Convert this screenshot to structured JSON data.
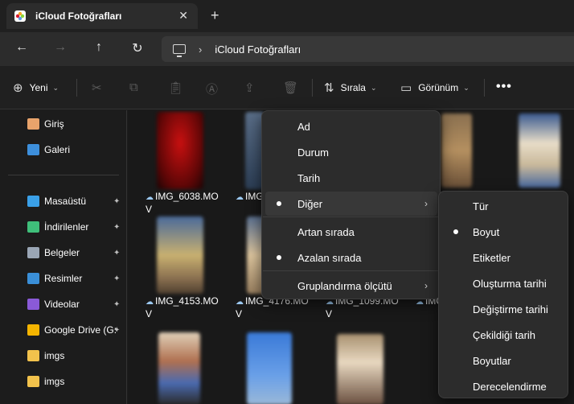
{
  "window": {
    "tab_title": "iCloud Fotoğrafları",
    "close_glyph": "✕",
    "new_tab_glyph": "+"
  },
  "nav": {
    "back_glyph": "←",
    "forward_glyph": "→",
    "up_glyph": "↑",
    "refresh_glyph": "↻",
    "breadcrumb_sep": "›",
    "path": "iCloud Fotoğrafları"
  },
  "toolbar": {
    "new_label": "Yeni",
    "sort_label": "Sırala",
    "view_label": "Görünüm",
    "more_label": "•••",
    "icons": [
      "cut-icon",
      "copy-icon",
      "paste-icon",
      "rename-icon",
      "share-icon",
      "delete-icon"
    ]
  },
  "sidebar": {
    "items": [
      {
        "label": "Giriş",
        "icon": "home-icon",
        "color": "#e8a36b",
        "pinned": false
      },
      {
        "label": "Galeri",
        "icon": "gallery-icon",
        "color": "#3d8fdc",
        "pinned": false
      },
      {
        "label": "Masaüstü",
        "icon": "desktop-icon",
        "color": "#3aa0e8",
        "pinned": true
      },
      {
        "label": "İndirilenler",
        "icon": "download-icon",
        "color": "#3fbf7a",
        "pinned": true
      },
      {
        "label": "Belgeler",
        "icon": "documents-icon",
        "color": "#9aa6b5",
        "pinned": true
      },
      {
        "label": "Resimler",
        "icon": "pictures-icon",
        "color": "#3a8fd8",
        "pinned": true
      },
      {
        "label": "Videolar",
        "icon": "videos-icon",
        "color": "#8a5ad8",
        "pinned": true
      },
      {
        "label": "Google Drive (G:",
        "icon": "google-drive-icon",
        "color": "#f4b400",
        "pinned": true
      },
      {
        "label": "imgs",
        "icon": "folder-icon",
        "color": "#f2c24c",
        "pinned": false
      },
      {
        "label": "imgs",
        "icon": "folder-icon",
        "color": "#f2c24c",
        "pinned": false
      }
    ],
    "pin_glyph": "📌"
  },
  "files": [
    {
      "name": "IMG_6038.MO\nV"
    },
    {
      "name": "IMG_"
    },
    {
      "name": ""
    },
    {
      "name": ""
    },
    {
      "name": "IMG_4153.MO\nV"
    },
    {
      "name": "IMG_4176.MO\nV"
    },
    {
      "name": "IMG_1099.MO\nV"
    },
    {
      "name": "IMG"
    }
  ],
  "sort_menu": {
    "items": [
      {
        "label": "Ad",
        "selected": false,
        "has_submenu": false
      },
      {
        "label": "Durum",
        "selected": false,
        "has_submenu": false
      },
      {
        "label": "Tarih",
        "selected": false,
        "has_submenu": false
      },
      {
        "label": "Diğer",
        "selected": true,
        "has_submenu": true
      },
      {
        "label": "Artan sırada",
        "selected": false,
        "has_submenu": false
      },
      {
        "label": "Azalan sırada",
        "selected": true,
        "has_submenu": false
      },
      {
        "label": "Gruplandırma ölçütü",
        "selected": false,
        "has_submenu": true
      }
    ],
    "arrow_glyph": "›"
  },
  "more_submenu": {
    "items": [
      {
        "label": "Tür",
        "selected": false
      },
      {
        "label": "Boyut",
        "selected": true
      },
      {
        "label": "Etiketler",
        "selected": false
      },
      {
        "label": "Oluşturma tarihi",
        "selected": false
      },
      {
        "label": "Değiştirme tarihi",
        "selected": false
      },
      {
        "label": "Çekildiği tarih",
        "selected": false
      },
      {
        "label": "Boyutlar",
        "selected": false
      },
      {
        "label": "Derecelendirme",
        "selected": false
      }
    ]
  },
  "colors": {
    "background": "#1c1c1c",
    "menu": "#2c2c2c",
    "accent": "#ffffff"
  }
}
